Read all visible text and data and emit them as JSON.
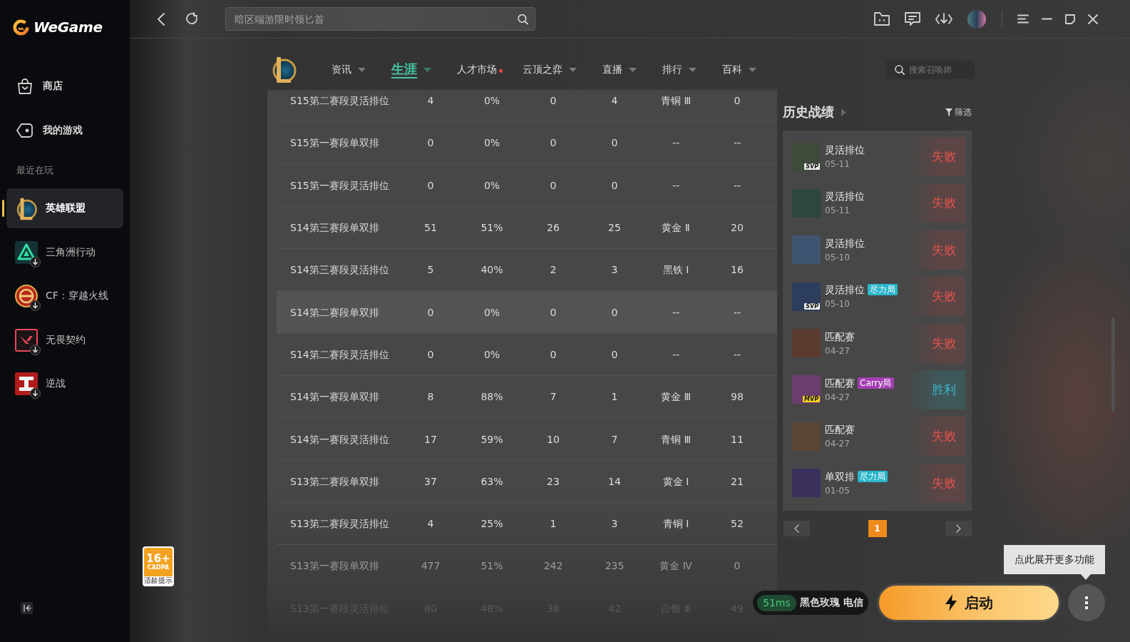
{
  "app": {
    "name": "WeGame"
  },
  "sidebar": {
    "nav": [
      {
        "label": "商店"
      },
      {
        "label": "我的游戏"
      }
    ],
    "section_title": "最近在玩",
    "games": [
      {
        "label": "英雄联盟",
        "selected": true,
        "installed": true
      },
      {
        "label": "三角洲行动",
        "selected": false,
        "installed": false
      },
      {
        "label": "CF：穿越火线",
        "selected": false,
        "installed": false
      },
      {
        "label": "无畏契约",
        "selected": false,
        "installed": false
      },
      {
        "label": "逆战",
        "selected": false,
        "installed": false
      }
    ]
  },
  "top_bar": {
    "search": {
      "placeholder": "暗区端游限时领匕首"
    }
  },
  "game_nav": {
    "tabs": [
      {
        "label": "资讯",
        "selected": false,
        "dropdown": true,
        "dot": false
      },
      {
        "label": "生涯",
        "selected": true,
        "dropdown": true,
        "dot": false
      },
      {
        "label": "人才市场",
        "selected": false,
        "dropdown": false,
        "dot": true
      },
      {
        "label": "云顶之弈",
        "selected": false,
        "dropdown": true,
        "dot": false
      },
      {
        "label": "直播",
        "selected": false,
        "dropdown": true,
        "dot": false
      },
      {
        "label": "排行",
        "selected": false,
        "dropdown": true,
        "dot": false
      },
      {
        "label": "百科",
        "selected": false,
        "dropdown": true,
        "dot": false
      }
    ],
    "search": {
      "placeholder": "搜索召唤师"
    }
  },
  "season_table": {
    "rows": [
      {
        "cells": [
          "S15第二赛段灵活排位",
          "4",
          "0%",
          "0",
          "4",
          "青铜 Ⅲ",
          "0"
        ],
        "highlighted": false
      },
      {
        "cells": [
          "S15第一赛段单双排",
          "0",
          "0%",
          "0",
          "0",
          "--",
          "--"
        ],
        "highlighted": false
      },
      {
        "cells": [
          "S15第一赛段灵活排位",
          "0",
          "0%",
          "0",
          "0",
          "--",
          "--"
        ],
        "highlighted": false
      },
      {
        "cells": [
          "S14第三赛段单双排",
          "51",
          "51%",
          "26",
          "25",
          "黄金 Ⅱ",
          "20"
        ],
        "highlighted": false
      },
      {
        "cells": [
          "S14第三赛段灵活排位",
          "5",
          "40%",
          "2",
          "3",
          "黑铁 Ⅰ",
          "16"
        ],
        "highlighted": false
      },
      {
        "cells": [
          "S14第二赛段单双排",
          "0",
          "0%",
          "0",
          "0",
          "--",
          "--"
        ],
        "highlighted": true
      },
      {
        "cells": [
          "S14第二赛段灵活排位",
          "0",
          "0%",
          "0",
          "0",
          "--",
          "--"
        ],
        "highlighted": false
      },
      {
        "cells": [
          "S14第一赛段单双排",
          "8",
          "88%",
          "7",
          "1",
          "黄金 Ⅲ",
          "98"
        ],
        "highlighted": false
      },
      {
        "cells": [
          "S14第一赛段灵活排位",
          "17",
          "59%",
          "10",
          "7",
          "青铜 Ⅲ",
          "11"
        ],
        "highlighted": false
      },
      {
        "cells": [
          "S13第二赛段单双排",
          "37",
          "63%",
          "23",
          "14",
          "黄金 Ⅰ",
          "21"
        ],
        "highlighted": false
      },
      {
        "cells": [
          "S13第二赛段灵活排位",
          "4",
          "25%",
          "1",
          "3",
          "青铜 Ⅰ",
          "52"
        ],
        "highlighted": false
      },
      {
        "cells": [
          "S13第一赛段单双排",
          "477",
          "51%",
          "242",
          "235",
          "黄金 Ⅳ",
          "0"
        ],
        "highlighted": false
      },
      {
        "cells": [
          "S13第一赛段灵活排位",
          "80",
          "48%",
          "38",
          "42",
          "白银 Ⅲ",
          "49"
        ],
        "highlighted": false
      }
    ]
  },
  "match_history": {
    "title": "历史战绩",
    "filter": "筛选",
    "matches": [
      {
        "mode": "灵活排位",
        "date": "05-11",
        "result": "失败",
        "kind": "loss",
        "badge": {
          "label": "SVP",
          "color": "#ececec"
        }
      },
      {
        "mode": "灵活排位",
        "date": "05-11",
        "result": "失败",
        "kind": "loss"
      },
      {
        "mode": "灵活排位",
        "date": "05-10",
        "result": "失败",
        "kind": "loss"
      },
      {
        "mode": "灵活排位",
        "date": "05-10",
        "result": "失败",
        "kind": "loss",
        "badge": {
          "label": "SVP",
          "color": "#ececec"
        },
        "tag": {
          "label": "尽力局",
          "color": "#2bb6cb"
        }
      },
      {
        "mode": "匹配赛",
        "date": "04-27",
        "result": "失败",
        "kind": "loss"
      },
      {
        "mode": "匹配赛",
        "date": "04-27",
        "result": "胜利",
        "kind": "win",
        "badge": {
          "label": "MVP",
          "color": "#f4d21c"
        },
        "tag": {
          "label": "Carry局",
          "color": "#a43fb4"
        }
      },
      {
        "mode": "匹配赛",
        "date": "04-27",
        "result": "失败",
        "kind": "loss"
      },
      {
        "mode": "单双排",
        "date": "01-05",
        "result": "失败",
        "kind": "loss",
        "tag": {
          "label": "尽力局",
          "color": "#2bb6cb"
        }
      }
    ],
    "pagination": {
      "pages": [
        {
          "label": "1",
          "selected": true
        }
      ]
    }
  },
  "age_rating": {
    "rating": "16+",
    "org": "CADPA",
    "caption": "适龄提示"
  },
  "launch": {
    "ping": "51ms",
    "server": "黑色玫瑰 电信",
    "button": "启动",
    "tooltip": "点此展开更多功能"
  }
}
